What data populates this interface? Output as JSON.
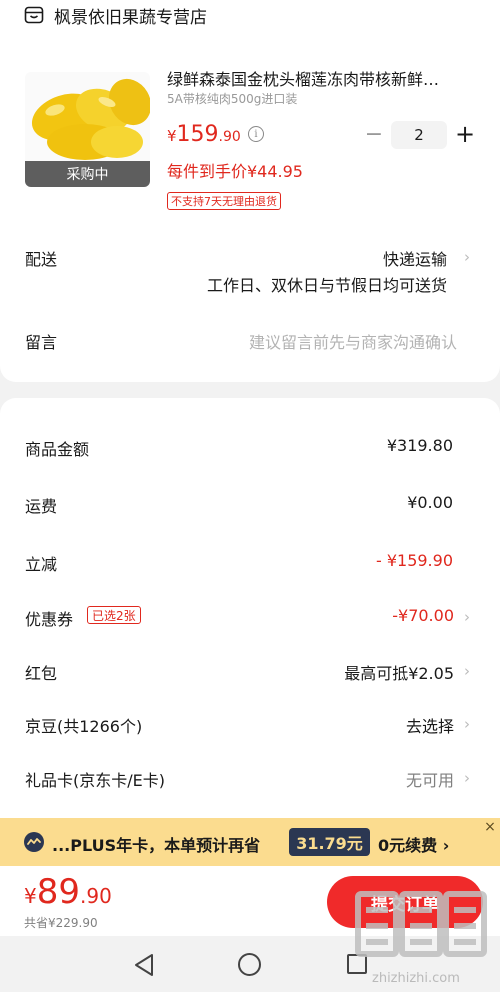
{
  "shop": {
    "name": "枫景依旧果蔬专营店",
    "icon": "store-icon"
  },
  "product": {
    "title": "绿鲜森泰国金枕头榴莲冻肉带核新鲜…",
    "spec": "5A带核纯肉500g进口装",
    "image_overlay": "采购中",
    "price_symbol": "¥",
    "price_int": "159",
    "price_dec": ".90",
    "unit_price": "每件到手价¥44.95",
    "return_policy": "不支持7天无理由退货",
    "info_icon_label": "i",
    "quantity": "2",
    "minus_label": "−",
    "plus_label": "+"
  },
  "delivery": {
    "label": "配送",
    "value": "快递运输",
    "note": "工作日、双休日与节假日均可送货"
  },
  "remark": {
    "label": "留言",
    "placeholder": "建议留言前先与商家沟通确认"
  },
  "summary": {
    "goods_amount": {
      "label": "商品金额",
      "value": "¥319.80"
    },
    "shipping": {
      "label": "运费",
      "value": "¥0.00"
    },
    "discount": {
      "label": "立减",
      "value": "- ¥159.90"
    },
    "coupon": {
      "label": "优惠券",
      "tag": "已选2张",
      "value": "-¥70.00"
    },
    "red_packet": {
      "label": "红包",
      "value": "最高可抵¥2.05"
    },
    "jingdou": {
      "label": "京豆(共1266个)",
      "value": "去选择"
    },
    "gift_card": {
      "label": "礼品卡(京东卡/E卡)",
      "value": "无可用"
    }
  },
  "plus_banner": {
    "text": "...PLUS年卡，本单预计再省",
    "amount": "31.79元",
    "renew": "0元续费 ›",
    "close": "×"
  },
  "footer": {
    "total_symbol": "¥",
    "total_int": "89",
    "total_dec": ".90",
    "saved": "共省¥229.90",
    "submit": "提交订单"
  },
  "watermark": {
    "text": "zhizhizhi.com"
  },
  "chevron": "›",
  "colors": {
    "accent_red": "#e0281e",
    "button_red": "#f02a2a",
    "plus_gold": "#fbdc8f",
    "plus_navy": "#2b3752"
  }
}
